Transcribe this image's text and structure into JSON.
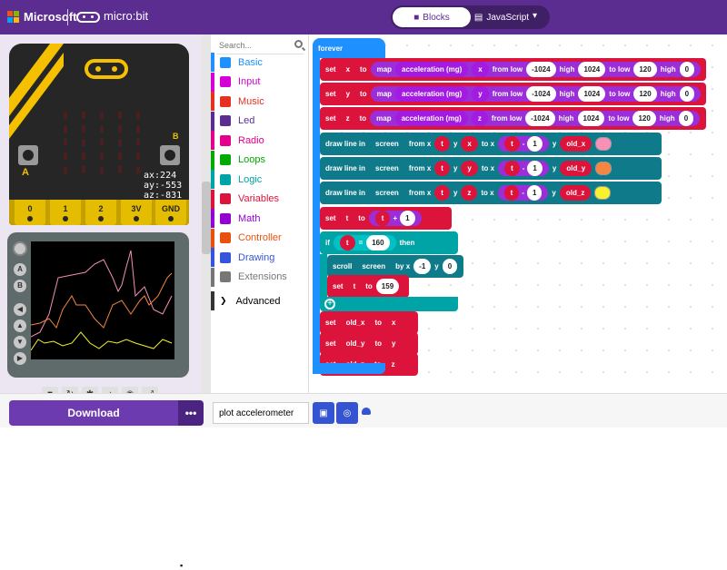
{
  "header": {
    "brand": "Microsoft",
    "product": "micro:bit",
    "tab_blocks": "Blocks",
    "tab_javascript": "JavaScript"
  },
  "simulator": {
    "readout": [
      "ax:224",
      "ay:-553",
      "az:-831"
    ],
    "button_a": "A",
    "button_b": "B",
    "pins": [
      "0",
      "1",
      "2",
      "3V",
      "GND"
    ]
  },
  "toolbox": {
    "search_placeholder": "Search...",
    "categories": [
      {
        "label": "Basic",
        "color": "#1e90ff"
      },
      {
        "label": "Input",
        "color": "#d400d4"
      },
      {
        "label": "Music",
        "color": "#e63022"
      },
      {
        "label": "Led",
        "color": "#5c2d91"
      },
      {
        "label": "Radio",
        "color": "#e3008c"
      },
      {
        "label": "Loops",
        "color": "#00aa00"
      },
      {
        "label": "Logic",
        "color": "#00a4a6"
      },
      {
        "label": "Variables",
        "color": "#dc143c"
      },
      {
        "label": "Math",
        "color": "#9400d3"
      },
      {
        "label": "Controller",
        "color": "#e8520e"
      },
      {
        "label": "Drawing",
        "color": "#3455db"
      },
      {
        "label": "Extensions",
        "color": "#777777"
      }
    ],
    "advanced": "Advanced"
  },
  "workspace": {
    "forever": "forever",
    "map_rows": [
      {
        "var": "x",
        "axis": "x"
      },
      {
        "var": "y",
        "axis": "y"
      },
      {
        "var": "z",
        "axis": "z"
      }
    ],
    "words": {
      "set": "set",
      "to": "to",
      "map": "map",
      "acceleration": "acceleration (mg)",
      "from_low": "from low",
      "high": "high",
      "to_low": "to low",
      "draw_line": "draw line in",
      "screen": "screen",
      "from_x": "from x",
      "y": "y",
      "to_x": "to x",
      "if": "if",
      "then": "then",
      "scroll": "scroll",
      "by_x": "by x"
    },
    "map_values": {
      "from_low": "-1024",
      "from_high": "1024",
      "to_low": "120",
      "to_high": "0"
    },
    "draw_rows": [
      {
        "var": "x",
        "old": "old_x",
        "color": "#f78fb6"
      },
      {
        "var": "y",
        "old": "old_y",
        "color": "#f5863f"
      },
      {
        "var": "z",
        "old": "old_z",
        "color": "#f7f22d"
      }
    ],
    "t_var": "t",
    "minus": "-",
    "plus": "+",
    "one": "1",
    "equals": "=",
    "if_value": "160",
    "scroll_x": "-1",
    "scroll_y": "0",
    "reset_value": "159",
    "old_rows": [
      {
        "old": "old_x",
        "var": "x"
      },
      {
        "old": "old_y",
        "var": "y"
      },
      {
        "old": "old_z",
        "var": "z"
      }
    ]
  },
  "footer": {
    "download": "Download",
    "more": "•••",
    "project_name": "plot accelerometer"
  }
}
